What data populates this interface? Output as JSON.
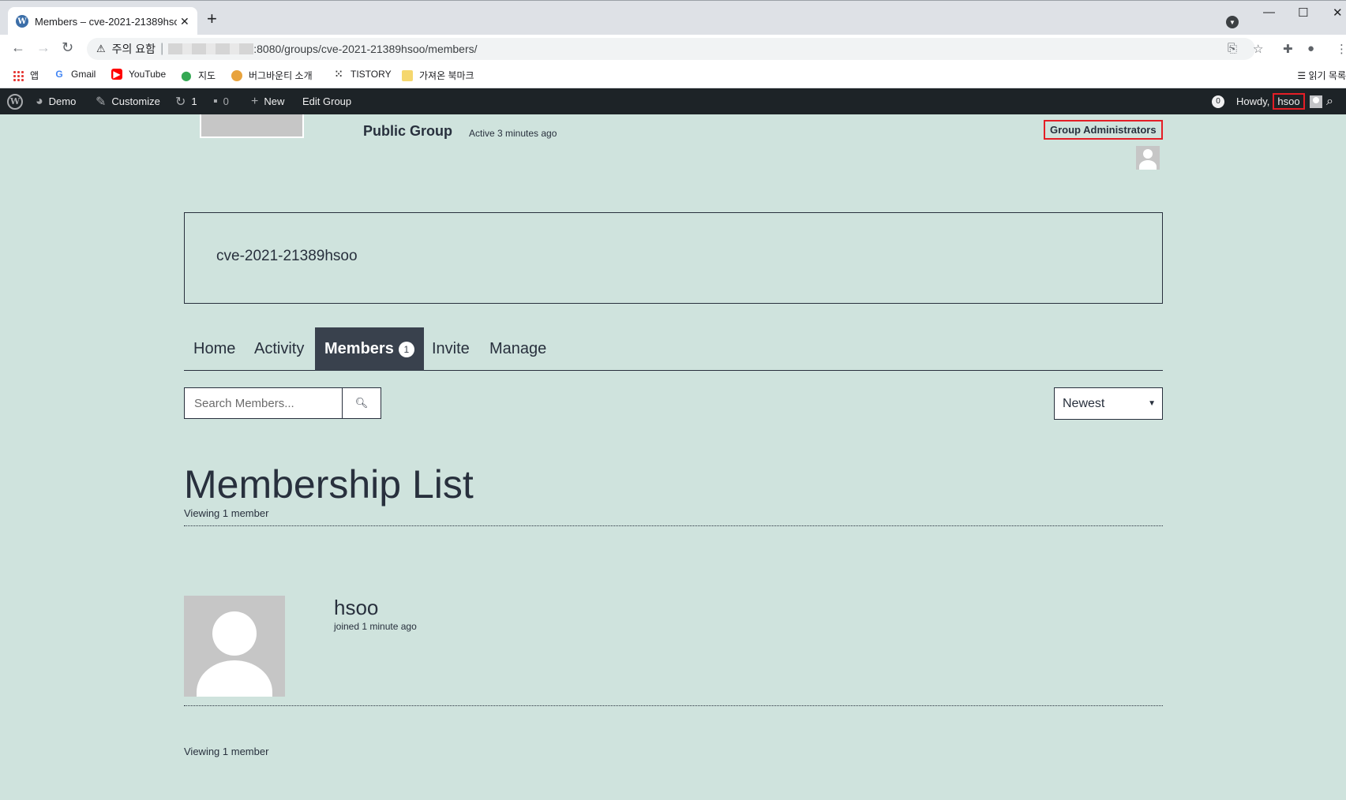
{
  "browser": {
    "tab_title": "Members – cve-2021-21389hsoo",
    "tab_favicon": "W",
    "new_tab": "+",
    "address": {
      "warning_label": "주의 요함",
      "url_path": ":8080/groups/cve-2021-21389hsoo/members/"
    },
    "bookmarks": [
      {
        "label": "앱",
        "icon": "apps-icon"
      },
      {
        "label": "Gmail",
        "icon": "google-icon"
      },
      {
        "label": "YouTube",
        "icon": "youtube-icon"
      },
      {
        "label": "지도",
        "icon": "maps-icon"
      },
      {
        "label": "버그바운티 소개",
        "icon": "bug-icon"
      },
      {
        "label": "TISTORY",
        "icon": "tistory-icon"
      },
      {
        "label": "가져온 북마크",
        "icon": "folder-icon"
      }
    ],
    "reading_list": "읽기 목록"
  },
  "adminbar": {
    "site_name": "Demo",
    "customize": "Customize",
    "updates_count": "1",
    "comments_count": "0",
    "new_label": "New",
    "edit_group": "Edit Group",
    "notifications_count": "0",
    "howdy": "Howdy,",
    "username": "hsoo"
  },
  "group": {
    "type": "Public Group",
    "last_active": "Active 3 minutes ago",
    "admins_label": "Group Administrators",
    "description": "cve-2021-21389hsoo"
  },
  "subnav": {
    "items": [
      {
        "label": "Home"
      },
      {
        "label": "Activity"
      },
      {
        "label": "Members",
        "count": "1",
        "active": true
      },
      {
        "label": "Invite"
      },
      {
        "label": "Manage"
      }
    ]
  },
  "search": {
    "placeholder": "Search Members..."
  },
  "order": {
    "selected": "Newest"
  },
  "list": {
    "title": "Membership List",
    "count_text_top": "Viewing 1 member",
    "count_text_bottom": "Viewing 1 member",
    "members": [
      {
        "name": "hsoo",
        "joined": "joined 1 minute ago"
      }
    ]
  },
  "colors": {
    "page_bg": "#cfe3dd",
    "text": "#28303d",
    "adminbar_bg": "#1d2327",
    "highlight": "#e41e26",
    "active_tab_bg": "#39414d"
  }
}
